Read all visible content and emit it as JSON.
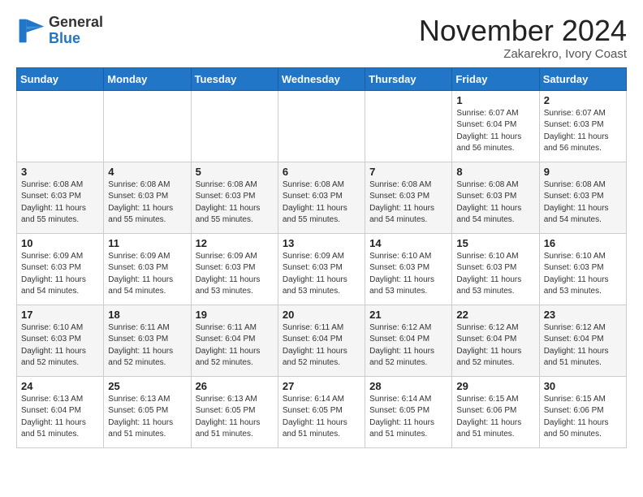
{
  "header": {
    "logo_general": "General",
    "logo_blue": "Blue",
    "month_title": "November 2024",
    "location": "Zakarekro, Ivory Coast"
  },
  "weekdays": [
    "Sunday",
    "Monday",
    "Tuesday",
    "Wednesday",
    "Thursday",
    "Friday",
    "Saturday"
  ],
  "weeks": [
    [
      {
        "day": "",
        "info": ""
      },
      {
        "day": "",
        "info": ""
      },
      {
        "day": "",
        "info": ""
      },
      {
        "day": "",
        "info": ""
      },
      {
        "day": "",
        "info": ""
      },
      {
        "day": "1",
        "info": "Sunrise: 6:07 AM\nSunset: 6:04 PM\nDaylight: 11 hours\nand 56 minutes."
      },
      {
        "day": "2",
        "info": "Sunrise: 6:07 AM\nSunset: 6:03 PM\nDaylight: 11 hours\nand 56 minutes."
      }
    ],
    [
      {
        "day": "3",
        "info": "Sunrise: 6:08 AM\nSunset: 6:03 PM\nDaylight: 11 hours\nand 55 minutes."
      },
      {
        "day": "4",
        "info": "Sunrise: 6:08 AM\nSunset: 6:03 PM\nDaylight: 11 hours\nand 55 minutes."
      },
      {
        "day": "5",
        "info": "Sunrise: 6:08 AM\nSunset: 6:03 PM\nDaylight: 11 hours\nand 55 minutes."
      },
      {
        "day": "6",
        "info": "Sunrise: 6:08 AM\nSunset: 6:03 PM\nDaylight: 11 hours\nand 55 minutes."
      },
      {
        "day": "7",
        "info": "Sunrise: 6:08 AM\nSunset: 6:03 PM\nDaylight: 11 hours\nand 54 minutes."
      },
      {
        "day": "8",
        "info": "Sunrise: 6:08 AM\nSunset: 6:03 PM\nDaylight: 11 hours\nand 54 minutes."
      },
      {
        "day": "9",
        "info": "Sunrise: 6:08 AM\nSunset: 6:03 PM\nDaylight: 11 hours\nand 54 minutes."
      }
    ],
    [
      {
        "day": "10",
        "info": "Sunrise: 6:09 AM\nSunset: 6:03 PM\nDaylight: 11 hours\nand 54 minutes."
      },
      {
        "day": "11",
        "info": "Sunrise: 6:09 AM\nSunset: 6:03 PM\nDaylight: 11 hours\nand 54 minutes."
      },
      {
        "day": "12",
        "info": "Sunrise: 6:09 AM\nSunset: 6:03 PM\nDaylight: 11 hours\nand 53 minutes."
      },
      {
        "day": "13",
        "info": "Sunrise: 6:09 AM\nSunset: 6:03 PM\nDaylight: 11 hours\nand 53 minutes."
      },
      {
        "day": "14",
        "info": "Sunrise: 6:10 AM\nSunset: 6:03 PM\nDaylight: 11 hours\nand 53 minutes."
      },
      {
        "day": "15",
        "info": "Sunrise: 6:10 AM\nSunset: 6:03 PM\nDaylight: 11 hours\nand 53 minutes."
      },
      {
        "day": "16",
        "info": "Sunrise: 6:10 AM\nSunset: 6:03 PM\nDaylight: 11 hours\nand 53 minutes."
      }
    ],
    [
      {
        "day": "17",
        "info": "Sunrise: 6:10 AM\nSunset: 6:03 PM\nDaylight: 11 hours\nand 52 minutes."
      },
      {
        "day": "18",
        "info": "Sunrise: 6:11 AM\nSunset: 6:03 PM\nDaylight: 11 hours\nand 52 minutes."
      },
      {
        "day": "19",
        "info": "Sunrise: 6:11 AM\nSunset: 6:04 PM\nDaylight: 11 hours\nand 52 minutes."
      },
      {
        "day": "20",
        "info": "Sunrise: 6:11 AM\nSunset: 6:04 PM\nDaylight: 11 hours\nand 52 minutes."
      },
      {
        "day": "21",
        "info": "Sunrise: 6:12 AM\nSunset: 6:04 PM\nDaylight: 11 hours\nand 52 minutes."
      },
      {
        "day": "22",
        "info": "Sunrise: 6:12 AM\nSunset: 6:04 PM\nDaylight: 11 hours\nand 52 minutes."
      },
      {
        "day": "23",
        "info": "Sunrise: 6:12 AM\nSunset: 6:04 PM\nDaylight: 11 hours\nand 51 minutes."
      }
    ],
    [
      {
        "day": "24",
        "info": "Sunrise: 6:13 AM\nSunset: 6:04 PM\nDaylight: 11 hours\nand 51 minutes."
      },
      {
        "day": "25",
        "info": "Sunrise: 6:13 AM\nSunset: 6:05 PM\nDaylight: 11 hours\nand 51 minutes."
      },
      {
        "day": "26",
        "info": "Sunrise: 6:13 AM\nSunset: 6:05 PM\nDaylight: 11 hours\nand 51 minutes."
      },
      {
        "day": "27",
        "info": "Sunrise: 6:14 AM\nSunset: 6:05 PM\nDaylight: 11 hours\nand 51 minutes."
      },
      {
        "day": "28",
        "info": "Sunrise: 6:14 AM\nSunset: 6:05 PM\nDaylight: 11 hours\nand 51 minutes."
      },
      {
        "day": "29",
        "info": "Sunrise: 6:15 AM\nSunset: 6:06 PM\nDaylight: 11 hours\nand 51 minutes."
      },
      {
        "day": "30",
        "info": "Sunrise: 6:15 AM\nSunset: 6:06 PM\nDaylight: 11 hours\nand 50 minutes."
      }
    ]
  ]
}
